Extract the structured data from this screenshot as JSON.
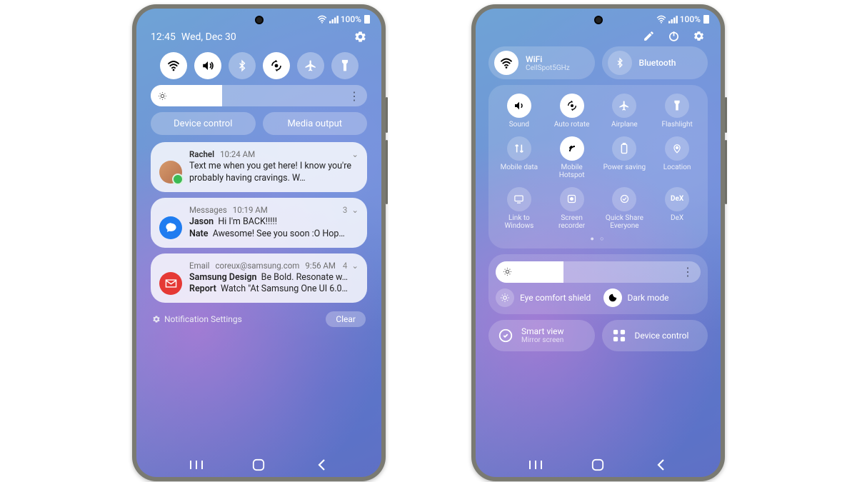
{
  "status_bar": {
    "battery_text": "100%"
  },
  "left": {
    "time": "12:45",
    "date": "Wed, Dec 30",
    "brightness_percent": 33,
    "device_control_label": "Device control",
    "media_output_label": "Media output",
    "notif_settings_label": "Notification Settings",
    "clear_label": "Clear",
    "notifs": [
      {
        "app": "Rachel",
        "time": "10:24 AM",
        "body": "Text me when you get here! I know you're probably having cravings. W…"
      },
      {
        "app": "Messages",
        "time": "10:19 AM",
        "count": "3",
        "lines": [
          {
            "name": "Jason",
            "text": "Hi I'm BACK!!!!!"
          },
          {
            "name": "Nate",
            "text": "Awesome! See you soon :O Hop…"
          }
        ]
      },
      {
        "app": "Email",
        "sender": "coreux@samsung.com",
        "time": "9:56 AM",
        "count": "4",
        "lines": [
          {
            "name": "Samsung Design",
            "text": "Be Bold. Resonate w…"
          },
          {
            "name": "Report",
            "text": "Watch \"At Samsung One UI 6.0…"
          }
        ]
      }
    ]
  },
  "right": {
    "wifi_title": "WiFi",
    "wifi_sub": "CellSpot5GHz",
    "bluetooth_title": "Bluetooth",
    "brightness_percent": 33,
    "tiles": [
      {
        "label": "Sound",
        "on": true
      },
      {
        "label": "Auto rotate",
        "on": true
      },
      {
        "label": "Airplane",
        "on": false
      },
      {
        "label": "Flashlight",
        "on": false
      },
      {
        "label": "Mobile data",
        "on": false
      },
      {
        "label": "Mobile Hotspot",
        "on": true
      },
      {
        "label": "Power saving",
        "on": false
      },
      {
        "label": "Location",
        "on": false
      },
      {
        "label": "Link to Windows",
        "on": false
      },
      {
        "label": "Screen recorder",
        "on": false
      },
      {
        "label": "Quick Share",
        "on": false,
        "sub": "Everyone"
      },
      {
        "label": "DeX",
        "on": false
      }
    ],
    "eye_comfort": "Eye comfort shield",
    "dark_mode": "Dark mode",
    "smart_view": "Smart view",
    "smart_view_sub": "Mirror screen",
    "device_control": "Device control"
  }
}
